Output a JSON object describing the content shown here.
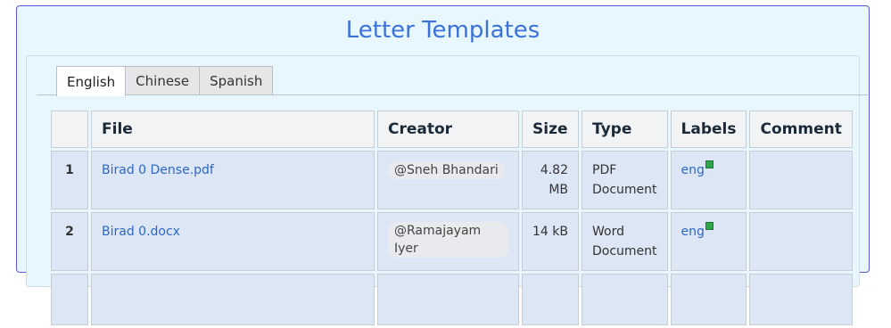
{
  "page": {
    "title": "Letter Templates"
  },
  "tabs": [
    {
      "label": "English",
      "active": true
    },
    {
      "label": "Chinese",
      "active": false
    },
    {
      "label": "Spanish",
      "active": false
    }
  ],
  "table": {
    "headers": [
      "",
      "File",
      "Creator",
      "Size",
      "Type",
      "Labels",
      "Comment"
    ],
    "rows": [
      {
        "num": "1",
        "file": "Birad 0 Dense.pdf",
        "creator": "Sneh Bhandari",
        "size": "4.82 MB",
        "type": "PDF Document",
        "label": "eng",
        "comment": ""
      },
      {
        "num": "2",
        "file": "Birad 0.docx",
        "creator": "Ramajayam Iyer",
        "size": "14 kB",
        "type": "Word Document",
        "label": "eng",
        "comment": ""
      },
      {
        "num": "",
        "file": "",
        "creator": "",
        "size": "",
        "type": "",
        "label": "",
        "comment": ""
      }
    ]
  },
  "icons": {
    "user": "at-sign-icon",
    "external": "external-link-icon"
  },
  "colors": {
    "accent": "#3c72d8",
    "border": "#5a57d8",
    "panel_bg": "#e8f7fd",
    "row_bg": "#dde6f5",
    "link": "#2d67c4"
  }
}
